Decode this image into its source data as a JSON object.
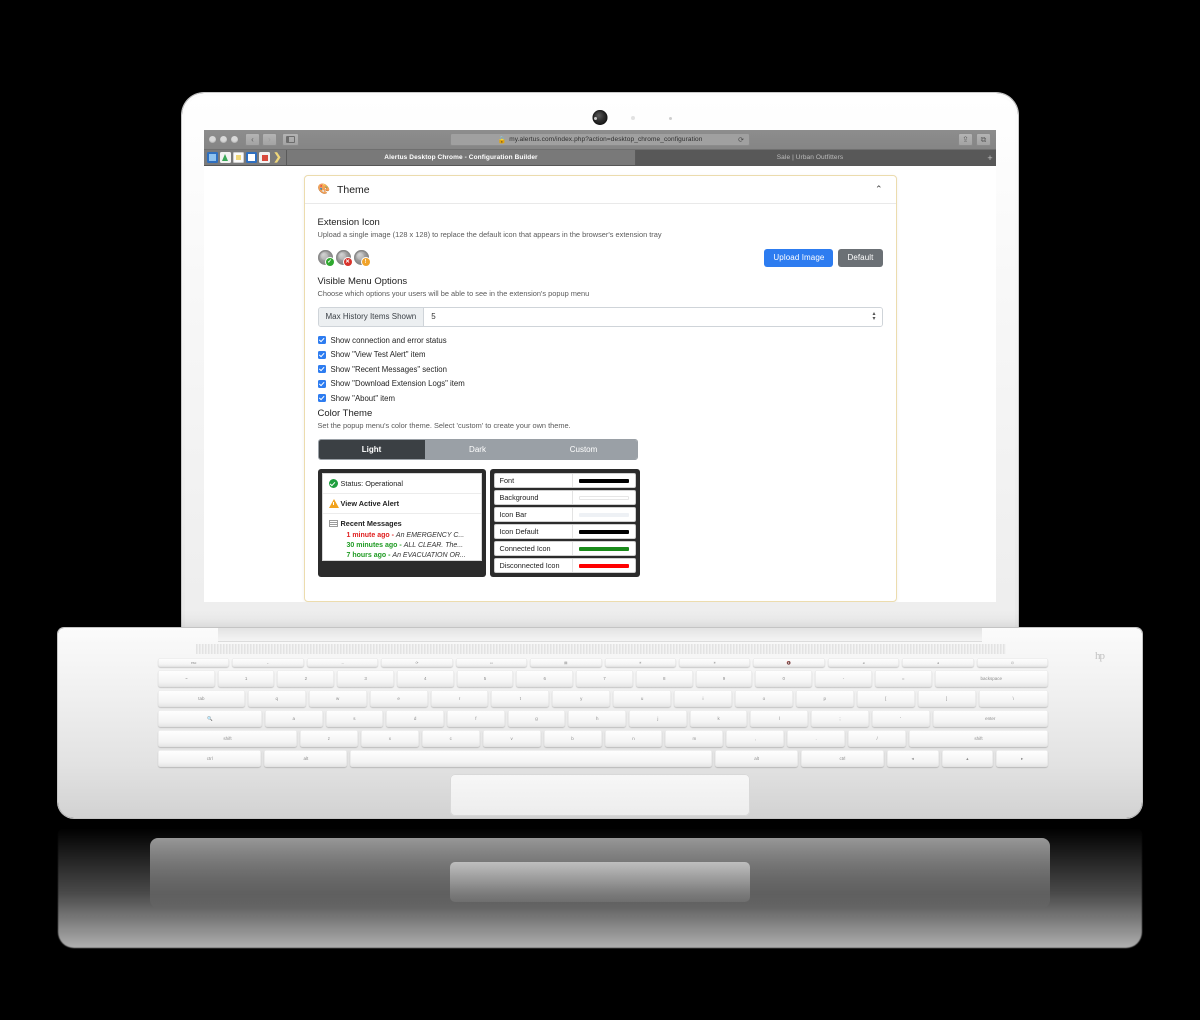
{
  "browser": {
    "url": "my.alertus.com/index.php?action=desktop_chrome_configuration",
    "lock_icon": "lock-icon",
    "reload_icon": "reload-icon",
    "back_icon": "back-arrow-icon",
    "forward_icon": "forward-arrow-icon",
    "sidebar_icon": "sidebar-toggle-icon",
    "share_icon": "share-icon",
    "newtab_label": "+",
    "tabs": [
      {
        "label": "Alertus Desktop Chrome - Configuration Builder",
        "active": true
      },
      {
        "label": "Sale | Urban Outfitters",
        "active": false
      }
    ],
    "bookmarks": [
      "bookmark-blue-icon",
      "bookmark-drive-icon",
      "bookmark-note-icon",
      "bookmark-book-icon",
      "bookmark-mail-icon",
      "bookmark-overflow-chevron"
    ]
  },
  "card": {
    "header": {
      "icon": "palette-icon",
      "title": "Theme",
      "collapse_icon": "chevron-up-icon"
    },
    "extension_icon": {
      "title": "Extension Icon",
      "description": "Upload a single image (128 x 128) to replace the default icon that appears in the browser's extension tray",
      "icons": [
        {
          "name": "icon-connected",
          "badge": "✓",
          "badge_color": "#2fa82f"
        },
        {
          "name": "icon-disconnected",
          "badge": "✕",
          "badge_color": "#d8322a"
        },
        {
          "name": "icon-alert",
          "badge": "!",
          "badge_color": "#f0a32a"
        }
      ],
      "upload_label": "Upload Image",
      "default_label": "Default"
    },
    "visible_menu": {
      "title": "Visible Menu Options",
      "description": "Choose which options your users will be able to see in the extension's popup menu",
      "field_label": "Max History Items Shown",
      "field_value": "5",
      "checkboxes": [
        {
          "label": "Show connection and error status",
          "checked": true
        },
        {
          "label": "Show \"View Test Alert\" item",
          "checked": true
        },
        {
          "label": "Show \"Recent Messages\" section",
          "checked": true
        },
        {
          "label": "Show \"Download Extension Logs\" item",
          "checked": true
        },
        {
          "label": "Show \"About\" item",
          "checked": true
        }
      ]
    },
    "color_theme": {
      "title": "Color Theme",
      "description": "Set the popup menu's color theme. Select 'custom' to create your own theme.",
      "segments": [
        {
          "label": "Light",
          "active": true
        },
        {
          "label": "Dark",
          "active": false
        },
        {
          "label": "Custom",
          "active": false
        }
      ]
    },
    "preview": {
      "status_label": "Status: Operational",
      "status_icon": "check-circle-icon",
      "alert_label": "View Active Alert",
      "alert_icon": "warning-triangle-icon",
      "recent_label": "Recent Messages",
      "recent_icon": "list-icon",
      "messages": [
        {
          "time": "1 minute ago - ",
          "text": "An EMERGENCY C...",
          "color": "red"
        },
        {
          "time": "30 minutes ago - ",
          "text": "ALL CLEAR. The...",
          "color": "green"
        },
        {
          "time": "7 hours ago - ",
          "text": "An EVACUATION OR...",
          "color": "green"
        }
      ],
      "swatches": [
        {
          "label": "Font",
          "color": "#000000"
        },
        {
          "label": "Background",
          "color": "#ffffff"
        },
        {
          "label": "Icon Bar",
          "color": "#eef1f5"
        },
        {
          "label": "Icon Default",
          "color": "#000000"
        },
        {
          "label": "Connected Icon",
          "color": "#1a8a1a"
        },
        {
          "label": "Disconnected Icon",
          "color": "#ff0000"
        }
      ]
    }
  },
  "laptop": {
    "logo": "hp"
  }
}
